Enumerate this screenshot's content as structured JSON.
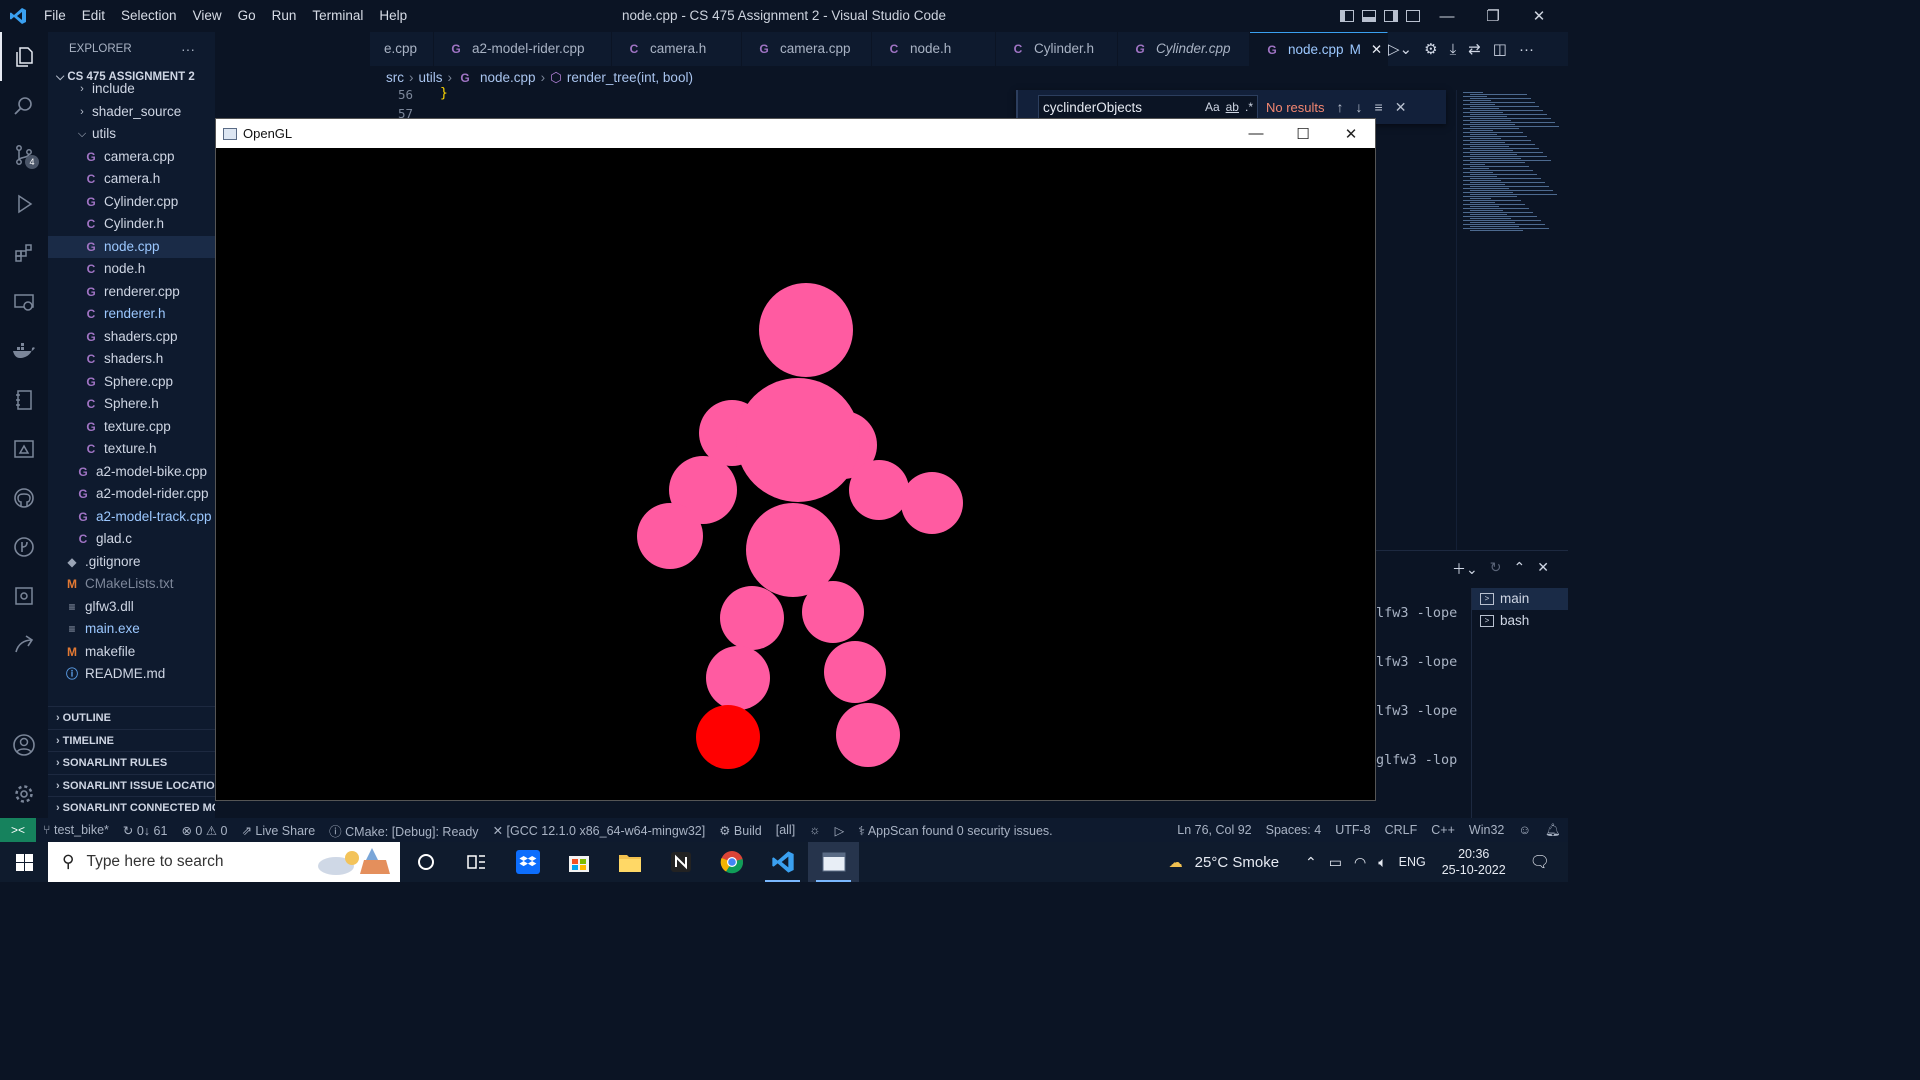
{
  "window": {
    "title": "node.cpp - CS 475 Assignment 2 - Visual Studio Code",
    "menu": [
      "File",
      "Edit",
      "Selection",
      "View",
      "Go",
      "Run",
      "Terminal",
      "Help"
    ]
  },
  "activity_bar": {
    "items": [
      "explorer-icon",
      "search-icon",
      "source-control-icon",
      "run-debug-icon",
      "extensions-icon",
      "remote-explorer-icon",
      "docker-icon",
      "notebook-icon",
      "cmake-icon",
      "github-icon",
      "gitlens-icon",
      "testing-icon",
      "live-share-icon"
    ],
    "source_control_badge": "4"
  },
  "sidebar": {
    "title": "EXPLORER",
    "more": "···",
    "folder": "CS 475 ASSIGNMENT 2",
    "items": [
      {
        "label": "include",
        "type": "folder",
        "depth": 1,
        "open": false
      },
      {
        "label": "shader_source",
        "type": "folder",
        "depth": 1,
        "open": false
      },
      {
        "label": "utils",
        "type": "folder",
        "depth": 1,
        "open": true
      },
      {
        "label": "camera.cpp",
        "type": "cpp",
        "depth": 2
      },
      {
        "label": "camera.h",
        "type": "c",
        "depth": 2
      },
      {
        "label": "Cylinder.cpp",
        "type": "cpp",
        "depth": 2
      },
      {
        "label": "Cylinder.h",
        "type": "c",
        "depth": 2
      },
      {
        "label": "node.cpp",
        "type": "cpp",
        "depth": 2,
        "selected": true,
        "modified": true
      },
      {
        "label": "node.h",
        "type": "c",
        "depth": 2
      },
      {
        "label": "renderer.cpp",
        "type": "cpp",
        "depth": 2
      },
      {
        "label": "renderer.h",
        "type": "c",
        "depth": 2,
        "modified": true
      },
      {
        "label": "shaders.cpp",
        "type": "cpp",
        "depth": 2
      },
      {
        "label": "shaders.h",
        "type": "c",
        "depth": 2
      },
      {
        "label": "Sphere.cpp",
        "type": "cpp",
        "depth": 2
      },
      {
        "label": "Sphere.h",
        "type": "c",
        "depth": 2
      },
      {
        "label": "texture.cpp",
        "type": "cpp",
        "depth": 2
      },
      {
        "label": "texture.h",
        "type": "c",
        "depth": 2
      },
      {
        "label": "a2-model-bike.cpp",
        "type": "cpp",
        "depth": 1
      },
      {
        "label": "a2-model-rider.cpp",
        "type": "cpp",
        "depth": 1
      },
      {
        "label": "a2-model-track.cpp",
        "type": "cpp",
        "depth": 1,
        "modified": true
      },
      {
        "label": "glad.c",
        "type": "c",
        "depth": 1
      },
      {
        "label": ".gitignore",
        "type": "git",
        "depth": 0
      },
      {
        "label": "CMakeLists.txt",
        "type": "m",
        "depth": 0,
        "dim": true
      },
      {
        "label": "glfw3.dll",
        "type": "txt",
        "depth": 0
      },
      {
        "label": "main.exe",
        "type": "txt",
        "depth": 0,
        "modified": true
      },
      {
        "label": "makefile",
        "type": "m",
        "depth": 0
      },
      {
        "label": "README.md",
        "type": "info",
        "depth": 0
      }
    ],
    "sections": [
      "OUTLINE",
      "TIMELINE",
      "SONARLINT RULES",
      "SONARLINT ISSUE LOCATIONS",
      "SONARLINT CONNECTED MODE"
    ]
  },
  "tabs": [
    {
      "label": "e.cpp",
      "type": "cpp"
    },
    {
      "label": "a2-model-rider.cpp",
      "type": "cpp"
    },
    {
      "label": "camera.h",
      "type": "c"
    },
    {
      "label": "camera.cpp",
      "type": "cpp"
    },
    {
      "label": "node.h",
      "type": "c"
    },
    {
      "label": "Cylinder.h",
      "type": "c"
    },
    {
      "label": "Cylinder.cpp",
      "type": "cpp",
      "italic": true
    },
    {
      "label": "node.cpp",
      "type": "cpp",
      "active": true,
      "status": "M"
    }
  ],
  "breadcrumb": {
    "parts": [
      "src",
      "utils",
      "node.cpp",
      "render_tree(int, bool)"
    ]
  },
  "editor": {
    "line_56": "56",
    "line_57": "57",
    "brace": "}"
  },
  "find": {
    "value": "cyclinderObjects",
    "match_case": "Aa",
    "whole_word": "ab",
    "regex": ".*",
    "result": "No results"
  },
  "terminal": {
    "lines": [
      "lfw3 -lope",
      "lfw3 -lope",
      "lfw3 -lope",
      "glfw3 -lop"
    ],
    "instances": [
      {
        "label": "main",
        "active": true
      },
      {
        "label": "bash",
        "active": false
      }
    ]
  },
  "opengl": {
    "title": "OpenGL",
    "figure_color": "#ff5ba1",
    "highlight_color": "#ff0000",
    "background": "#000000"
  },
  "statusbar": {
    "branch": "test_bike*",
    "sync": "0↓ 61",
    "problems": "0 ⚠ 0",
    "live_share": "Live Share",
    "cmake": "CMake: [Debug]: Ready",
    "kit": "[GCC 12.1.0 x86_64-w64-mingw32]",
    "build": "Build",
    "target": "[all]",
    "appscan": "AppScan found 0 security issues.",
    "position": "Ln 76, Col 92",
    "spaces": "Spaces: 4",
    "encoding": "UTF-8",
    "eol": "CRLF",
    "language": "C++",
    "platform": "Win32"
  },
  "taskbar": {
    "search_placeholder": "Type here to search",
    "apps": [
      "cortana-icon",
      "task-view-icon",
      "dropbox-icon",
      "store-icon",
      "file-explorer-icon",
      "notion-icon",
      "chrome-icon",
      "vscode-icon",
      "opengl-window-icon"
    ],
    "weather": "25°C  Smoke",
    "lang": "ENG",
    "time": "20:36",
    "date": "25-10-2022"
  }
}
